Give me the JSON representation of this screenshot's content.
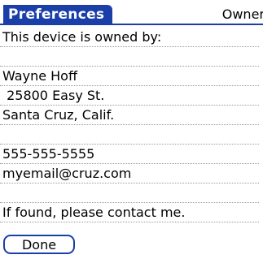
{
  "app": {
    "title": "Preferences",
    "category": "Owner"
  },
  "lines": [
    "This device is owned by:",
    "",
    "Wayne Hoff",
    " 25800 Easy St.",
    "Santa Cruz, Calif.",
    "",
    "555-555-5555",
    "myemail@cruz.com",
    "",
    "If found, please contact me.",
    ""
  ],
  "buttons": {
    "done": "Done"
  },
  "colors": {
    "accent": "#1a3fa8"
  }
}
